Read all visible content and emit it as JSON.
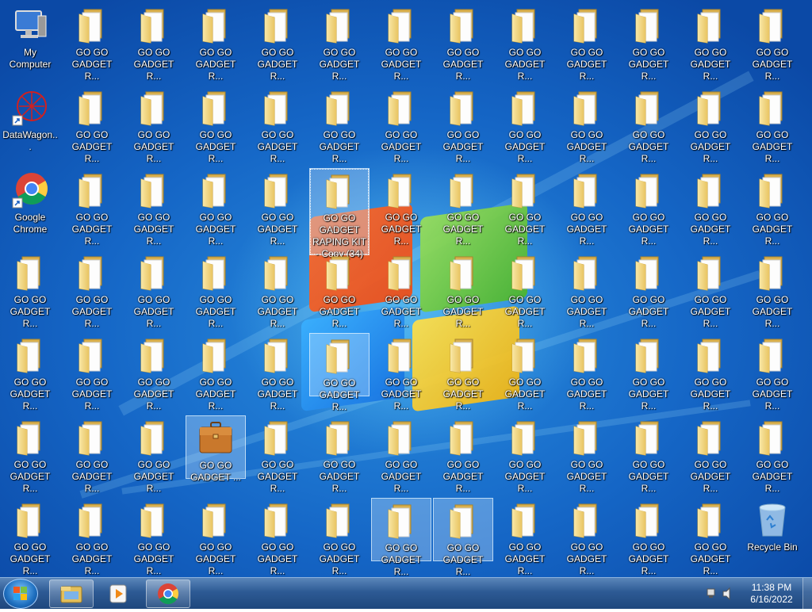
{
  "desktop": {
    "my_computer": "My Computer",
    "datawagon": "DataWagon...",
    "chrome": "Google Chrome",
    "recycle_bin": "Recycle Bin",
    "folder_label": "GO GO GADGET R...",
    "selected_folder_label": "GO GO GADGET RAPING KIT - Copy (34)",
    "briefcase_label": "GO GO GADGET ..."
  },
  "taskbar": {
    "time": "11:38 PM",
    "date": "6/16/2022",
    "pinned": [
      "explorer-icon",
      "media-player-icon",
      "chrome-icon"
    ]
  }
}
